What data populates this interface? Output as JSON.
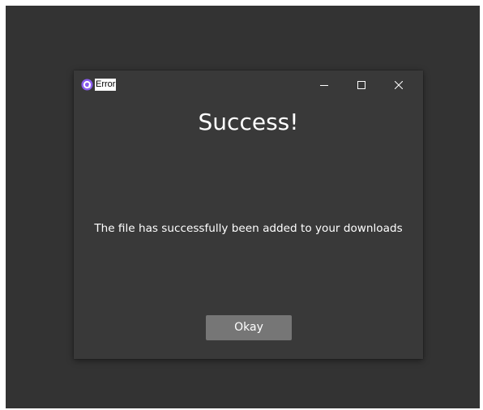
{
  "window": {
    "title": "Error",
    "app_icon": "app-logo-icon",
    "controls": {
      "minimize_icon": "minimize-icon",
      "maximize_icon": "maximize-icon",
      "close_icon": "close-icon"
    }
  },
  "dialog": {
    "heading": "Success!",
    "message": "The file has successfully been added to your downloads",
    "okay_label": "Okay"
  },
  "colors": {
    "desktop_background": "#333333",
    "window_background": "#393939",
    "button_background": "#767676",
    "text": "#ffffff",
    "app_icon_accent": "#8a5cf0"
  }
}
